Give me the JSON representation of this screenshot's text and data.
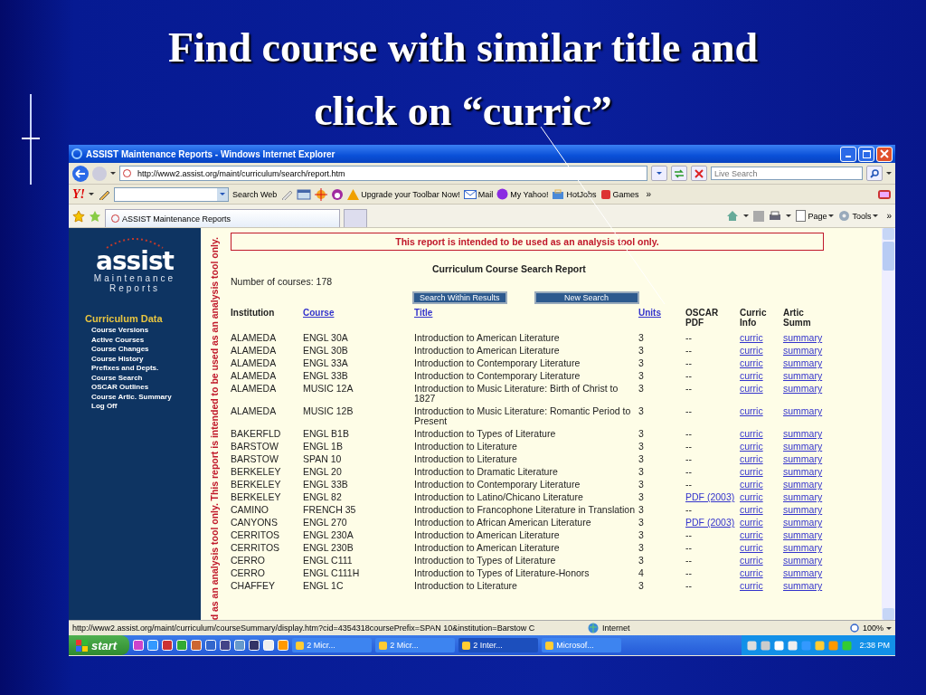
{
  "slide": {
    "title": "Find course with similar title and click on “curric”"
  },
  "window": {
    "title": "ASSIST Maintenance Reports - Windows Internet Explorer"
  },
  "address_bar": {
    "url": "http://www2.assist.org/maint/curriculum/search/report.htm",
    "search_placeholder": "Live Search"
  },
  "yahoo_toolbar": {
    "logo": "Y!",
    "search_button": "Search Web",
    "items": [
      "Upgrade your Toolbar Now!",
      "Mail",
      "My Yahoo!",
      "HotJobs",
      "Games"
    ],
    "more": "»"
  },
  "tabs": [
    {
      "label": "ASSIST Maintenance Reports",
      "selected": true
    }
  ],
  "command_bar": {
    "items": [
      "Page",
      "Tools"
    ],
    "more": "»"
  },
  "sidebar": {
    "logo": "assist",
    "subtitle": [
      "Maintenance",
      "Reports"
    ],
    "heading": "Curriculum Data",
    "links": [
      "Course Versions",
      "Active Courses",
      "Course Changes",
      "Course History",
      "Prefixes and Depts.",
      "Course Search",
      "OSCAR Outlines",
      "Course Artic. Summary",
      "Log Off"
    ]
  },
  "vertical_notices": [
    "This report is intended to be used as an analysis tool only.",
    "d as an analysis tool only."
  ],
  "report": {
    "notice": "This report is intended to be used as an analysis tool only.",
    "title": "Curriculum Course Search Report",
    "count": "Number of courses: 178",
    "buttons": [
      "Search Within Results",
      "New Search"
    ],
    "columns": [
      {
        "label": "Institution",
        "link": false
      },
      {
        "label": "Course",
        "link": true
      },
      {
        "label": "Title",
        "link": true
      },
      {
        "label": "Units",
        "link": true
      },
      {
        "label": "OSCAR PDF",
        "link": false
      },
      {
        "label": "Curric Info",
        "link": false
      },
      {
        "label": "Artic Summ",
        "link": false
      }
    ],
    "rows": [
      {
        "institution": "ALAMEDA",
        "course": "ENGL 30A",
        "title": "Introduction to American Literature",
        "units": "3",
        "oscar": {
          "kind": "text",
          "text": "--"
        },
        "curric": "curric",
        "summary": "summary"
      },
      {
        "institution": "ALAMEDA",
        "course": "ENGL 30B",
        "title": "Introduction to American Literature",
        "units": "3",
        "oscar": {
          "kind": "text",
          "text": "--"
        },
        "curric": "curric",
        "summary": "summary"
      },
      {
        "institution": "ALAMEDA",
        "course": "ENGL 33A",
        "title": "Introduction to Contemporary Literature",
        "units": "3",
        "oscar": {
          "kind": "text",
          "text": "--"
        },
        "curric": "curric",
        "summary": "summary"
      },
      {
        "institution": "ALAMEDA",
        "course": "ENGL 33B",
        "title": "Introduction to Contemporary Literature",
        "units": "3",
        "oscar": {
          "kind": "text",
          "text": "--"
        },
        "curric": "curric",
        "summary": "summary"
      },
      {
        "institution": "ALAMEDA",
        "course": "MUSIC 12A",
        "title": "Introduction to Music Literature: Birth of Christ to 1827",
        "units": "3",
        "oscar": {
          "kind": "text",
          "text": "--"
        },
        "curric": "curric",
        "summary": "summary"
      },
      {
        "institution": "ALAMEDA",
        "course": "MUSIC 12B",
        "title": "Introduction to Music Literature: Romantic Period to Present",
        "units": "3",
        "oscar": {
          "kind": "text",
          "text": "--"
        },
        "curric": "curric",
        "summary": "summary"
      },
      {
        "institution": "BAKERFLD",
        "course": "ENGL B1B",
        "title": "Introduction to Types of Literature",
        "units": "3",
        "oscar": {
          "kind": "text",
          "text": "--"
        },
        "curric": "curric",
        "summary": "summary"
      },
      {
        "institution": "BARSTOW",
        "course": "ENGL 1B",
        "title": "Introduction to Literature",
        "units": "3",
        "oscar": {
          "kind": "text",
          "text": "--"
        },
        "curric": "curric",
        "summary": "summary"
      },
      {
        "institution": "BARSTOW",
        "course": "SPAN 10",
        "title": "Introduction to Literature",
        "units": "3",
        "oscar": {
          "kind": "text",
          "text": "--"
        },
        "curric": "curric",
        "summary": "summary"
      },
      {
        "institution": "BERKELEY",
        "course": "ENGL 20",
        "title": "Introduction to Dramatic Literature",
        "units": "3",
        "oscar": {
          "kind": "text",
          "text": "--"
        },
        "curric": "curric",
        "summary": "summary"
      },
      {
        "institution": "BERKELEY",
        "course": "ENGL 33B",
        "title": "Introduction to Contemporary Literature",
        "units": "3",
        "oscar": {
          "kind": "text",
          "text": "--"
        },
        "curric": "curric",
        "summary": "summary"
      },
      {
        "institution": "BERKELEY",
        "course": "ENGL 82",
        "title": "Introduction to Latino/Chicano Literature",
        "units": "3",
        "oscar": {
          "kind": "link",
          "text": "PDF (2003)"
        },
        "curric": "curric",
        "summary": "summary"
      },
      {
        "institution": "CAMINO",
        "course": "FRENCH 35",
        "title": "Introduction to Francophone Literature in Translation",
        "units": "3",
        "oscar": {
          "kind": "text",
          "text": "--"
        },
        "curric": "curric",
        "summary": "summary"
      },
      {
        "institution": "CANYONS",
        "course": "ENGL 270",
        "title": "Introduction to African American Literature",
        "units": "3",
        "oscar": {
          "kind": "link",
          "text": "PDF (2003)"
        },
        "curric": "curric",
        "summary": "summary"
      },
      {
        "institution": "CERRITOS",
        "course": "ENGL 230A",
        "title": "Introduction to American Literature",
        "units": "3",
        "oscar": {
          "kind": "text",
          "text": "--"
        },
        "curric": "curric",
        "summary": "summary"
      },
      {
        "institution": "CERRITOS",
        "course": "ENGL 230B",
        "title": "Introduction to American Literature",
        "units": "3",
        "oscar": {
          "kind": "text",
          "text": "--"
        },
        "curric": "curric",
        "summary": "summary"
      },
      {
        "institution": "CERRO",
        "course": "ENGL C111",
        "title": "Introduction to Types of Literature",
        "units": "3",
        "oscar": {
          "kind": "text",
          "text": "--"
        },
        "curric": "curric",
        "summary": "summary"
      },
      {
        "institution": "CERRO",
        "course": "ENGL C111H",
        "title": "Introduction to Types of Literature-Honors",
        "units": "4",
        "oscar": {
          "kind": "text",
          "text": "--"
        },
        "curric": "curric",
        "summary": "summary"
      },
      {
        "institution": "CHAFFEY",
        "course": "ENGL 1C",
        "title": "Introduction to Literature",
        "units": "3",
        "oscar": {
          "kind": "text",
          "text": "--"
        },
        "curric": "curric",
        "summary": "summary"
      }
    ]
  },
  "status_bar": {
    "url": "http://www2.assist.org/maint/curriculum/courseSummary/display.htm?cid=4354318coursePrefix=SPAN 10&institution=Barstow C",
    "zone": "Internet",
    "zoom": "100%"
  },
  "taskbar": {
    "start": "start",
    "tasks": [
      {
        "label": "2 Micr...",
        "selected": false
      },
      {
        "label": "2 Micr...",
        "selected": false
      },
      {
        "label": "2 Inter...",
        "selected": true
      },
      {
        "label": "Microsof...",
        "selected": false
      }
    ],
    "clock": "2:38 PM"
  }
}
